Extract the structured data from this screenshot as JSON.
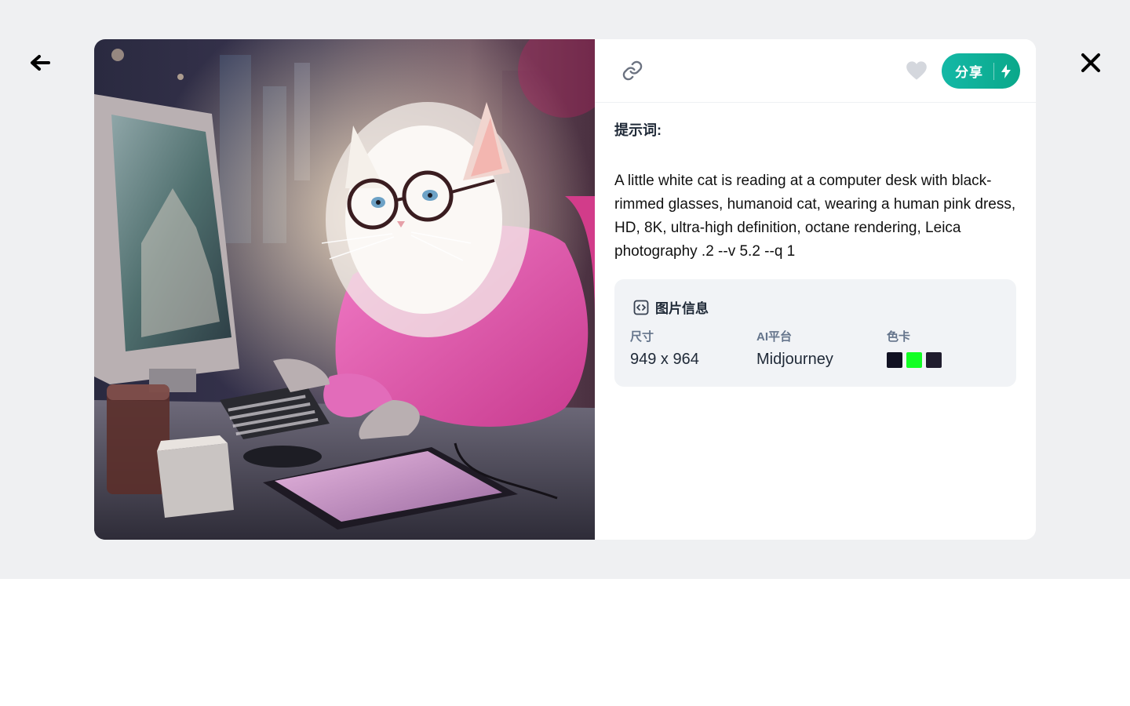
{
  "overlay": {
    "back_icon": "arrow-left-icon",
    "close_icon": "close-icon"
  },
  "image": {
    "icon": "white cat with glasses in pink hoodie at computer"
  },
  "toolbar": {
    "link_icon": "link-icon",
    "like_icon": "heart-icon",
    "share_label": "分享",
    "share_icon": "lightning-bolt-icon",
    "share_color": "#10b5a0"
  },
  "prompt": {
    "title": "提示词:",
    "text": "A little white cat is reading at a computer desk with black-rimmed glasses, humanoid cat, wearing a human pink dress, HD, 8K, ultra-high definition, octane rendering, Leica photography .2 --v 5.2 --q 1"
  },
  "image_info": {
    "heading": "图片信息",
    "heading_icon": "code-icon",
    "size_label": "尺寸",
    "size_value": "949 x 964",
    "platform_label": "AI平台",
    "platform_value": "Midjourney",
    "palette_label": "色卡",
    "palette": [
      "#111122",
      "#12ff24",
      "#201d2e"
    ]
  }
}
